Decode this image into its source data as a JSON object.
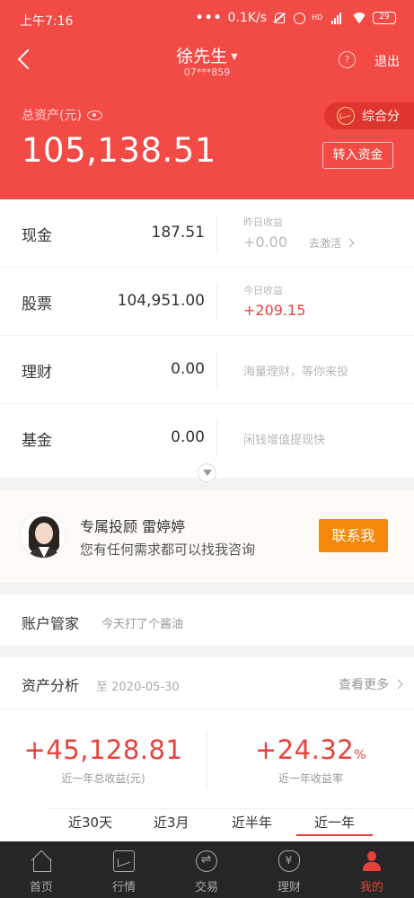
{
  "status_bar": {
    "time": "上午7:16",
    "net_speed": "0.1K/s",
    "hd": "HD",
    "battery": "29"
  },
  "nav": {
    "user_name": "徐先生",
    "account_id": "07***859",
    "help": "?",
    "logout": "退出"
  },
  "summary": {
    "total_label": "总资产(元)",
    "total_value": "105,138.51",
    "score_label": "综合分",
    "deposit_label": "转入资金"
  },
  "assets": [
    {
      "name": "现金",
      "amount": "187.51",
      "sub_label": "昨日收益",
      "sub_value": "+0.00",
      "link": "去激活"
    },
    {
      "name": "股票",
      "amount": "104,951.00",
      "sub_label": "今日收益",
      "sub_value": "+209.15"
    },
    {
      "name": "理财",
      "amount": "0.00",
      "note": "海量理财，等你来投"
    },
    {
      "name": "基金",
      "amount": "0.00",
      "note": "闲钱增值提现快"
    }
  ],
  "advisor": {
    "title": "专属投顾 雷婷婷",
    "subtitle": "您有任何需求都可以找我咨询",
    "contact_label": "联系我"
  },
  "account_manager": {
    "title": "账户管家",
    "subtitle": "今天打了个酱油"
  },
  "analysis": {
    "title": "资产分析",
    "date": "至 2020-05-30",
    "more": "查看更多",
    "total_gain": "+45,128.81",
    "total_gain_label": "近一年总收益(元)",
    "gain_rate": "+24.32",
    "gain_rate_unit": "%",
    "gain_rate_label": "近一年收益率",
    "periods": [
      "近30天",
      "近3月",
      "近半年",
      "近一年"
    ],
    "active_period": "近一年"
  },
  "tabbar": {
    "items": [
      "首页",
      "行情",
      "交易",
      "理财",
      "我的"
    ],
    "active": "我的"
  },
  "colors": {
    "header_red": "#f24a44",
    "accent_red": "#e8413c",
    "contact_orange": "#f5870b",
    "tabbar_bg": "#262626"
  }
}
